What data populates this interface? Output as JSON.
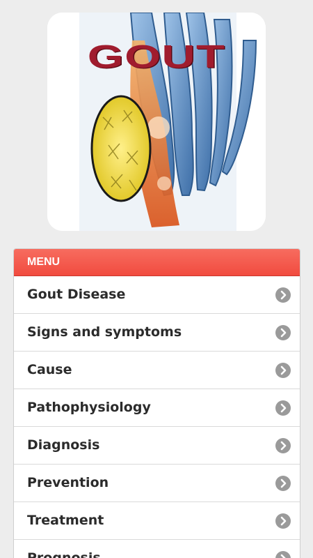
{
  "hero": {
    "title": "GOUT",
    "image_icon": "gout-foot-illustration"
  },
  "menu": {
    "header": "MENU",
    "item_icon": "chevron-right-circle-icon",
    "items": [
      {
        "label": "Gout Disease"
      },
      {
        "label": "Signs and symptoms"
      },
      {
        "label": "Cause"
      },
      {
        "label": "Pathophysiology"
      },
      {
        "label": "Diagnosis"
      },
      {
        "label": "Prevention"
      },
      {
        "label": "Treatment"
      },
      {
        "label": "Prognosis"
      }
    ]
  },
  "colors": {
    "background": "#ededed",
    "menu_header": "#f25a4c",
    "title_red": "#a01c2e",
    "chevron": "#9a9a9a"
  }
}
